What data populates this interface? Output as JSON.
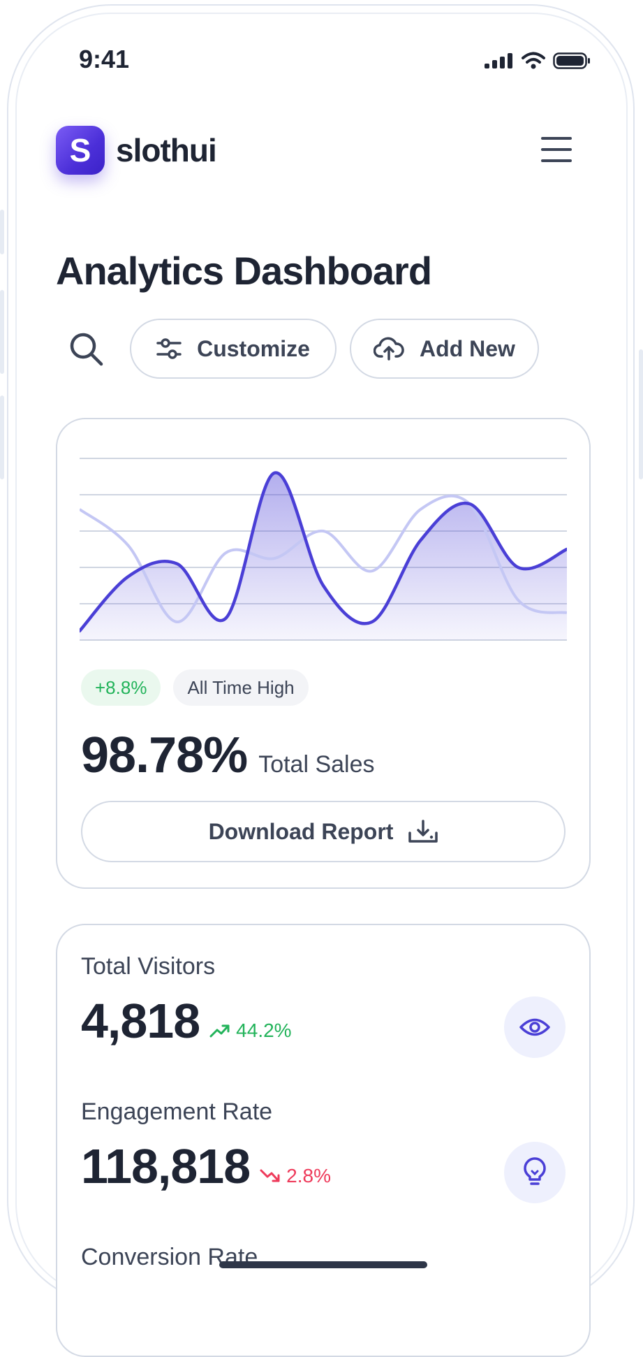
{
  "status_bar": {
    "time": "9:41"
  },
  "header": {
    "brand_letter": "S",
    "brand_name": "slothui"
  },
  "page": {
    "title": "Analytics Dashboard"
  },
  "toolbar": {
    "customize_label": "Customize",
    "add_new_label": "Add New"
  },
  "sales_card": {
    "change_badge": "+8.8%",
    "status_badge": "All Time High",
    "value": "98.78%",
    "value_label": "Total Sales",
    "download_label": "Download Report"
  },
  "chart_data": {
    "type": "area",
    "series": [
      {
        "values": [
          5,
          35,
          42,
          12,
          92,
          30,
          10,
          55,
          75,
          40,
          50
        ]
      },
      {
        "values": [
          72,
          52,
          10,
          48,
          45,
          60,
          38,
          72,
          75,
          22,
          15
        ]
      }
    ],
    "grid": true,
    "colors": {
      "primary": "#4a3fd6",
      "secondary": "#c4c7f4"
    }
  },
  "metrics": [
    {
      "label": "Total Visitors",
      "value": "4,818",
      "change": "44.2%",
      "direction": "up",
      "icon": "eye-icon"
    },
    {
      "label": "Engagement Rate",
      "value": "118,818",
      "change": "2.8%",
      "direction": "down",
      "icon": "lightbulb-icon"
    },
    {
      "label": "Conversion Rate"
    }
  ],
  "colors": {
    "brand": "#4b2fd8",
    "positive": "#22b35a",
    "negative": "#ee3a5a",
    "text": "#1e2433"
  }
}
